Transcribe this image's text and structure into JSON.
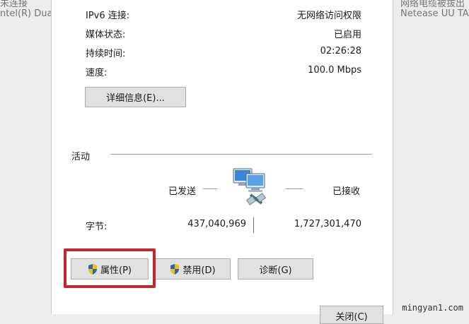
{
  "background": {
    "left_line1": "未连接",
    "left_line2": "ntel(R) Dual",
    "right_line1": "网络电缆被拔出",
    "right_line2": "Netease UU TA"
  },
  "details": [
    {
      "label": "IPv6 连接:",
      "value": "无网络访问权限"
    },
    {
      "label": "媒体状态:",
      "value": "已启用"
    },
    {
      "label": "持续时间:",
      "value": "02:26:28"
    },
    {
      "label": "速度:",
      "value": "100.0 Mbps"
    }
  ],
  "details_button": "详细信息(E)...",
  "activity": {
    "title": "活动",
    "sent_label": "已发送",
    "received_label": "已接收",
    "bytes_label": "字节:",
    "sent_bytes": "437,040,969",
    "received_bytes": "1,727,301,470"
  },
  "buttons": {
    "properties": "属性(P)",
    "disable": "禁用(D)",
    "diagnose": "诊断(G)",
    "close": "关闭(C)"
  },
  "watermark": "mingyan1.com",
  "icons": {
    "network_activity": "network-computers-icon",
    "shield": "uac-shield-icon"
  },
  "colors": {
    "highlight_box": "#c0282d",
    "button_bg": "#e1e1e1"
  }
}
